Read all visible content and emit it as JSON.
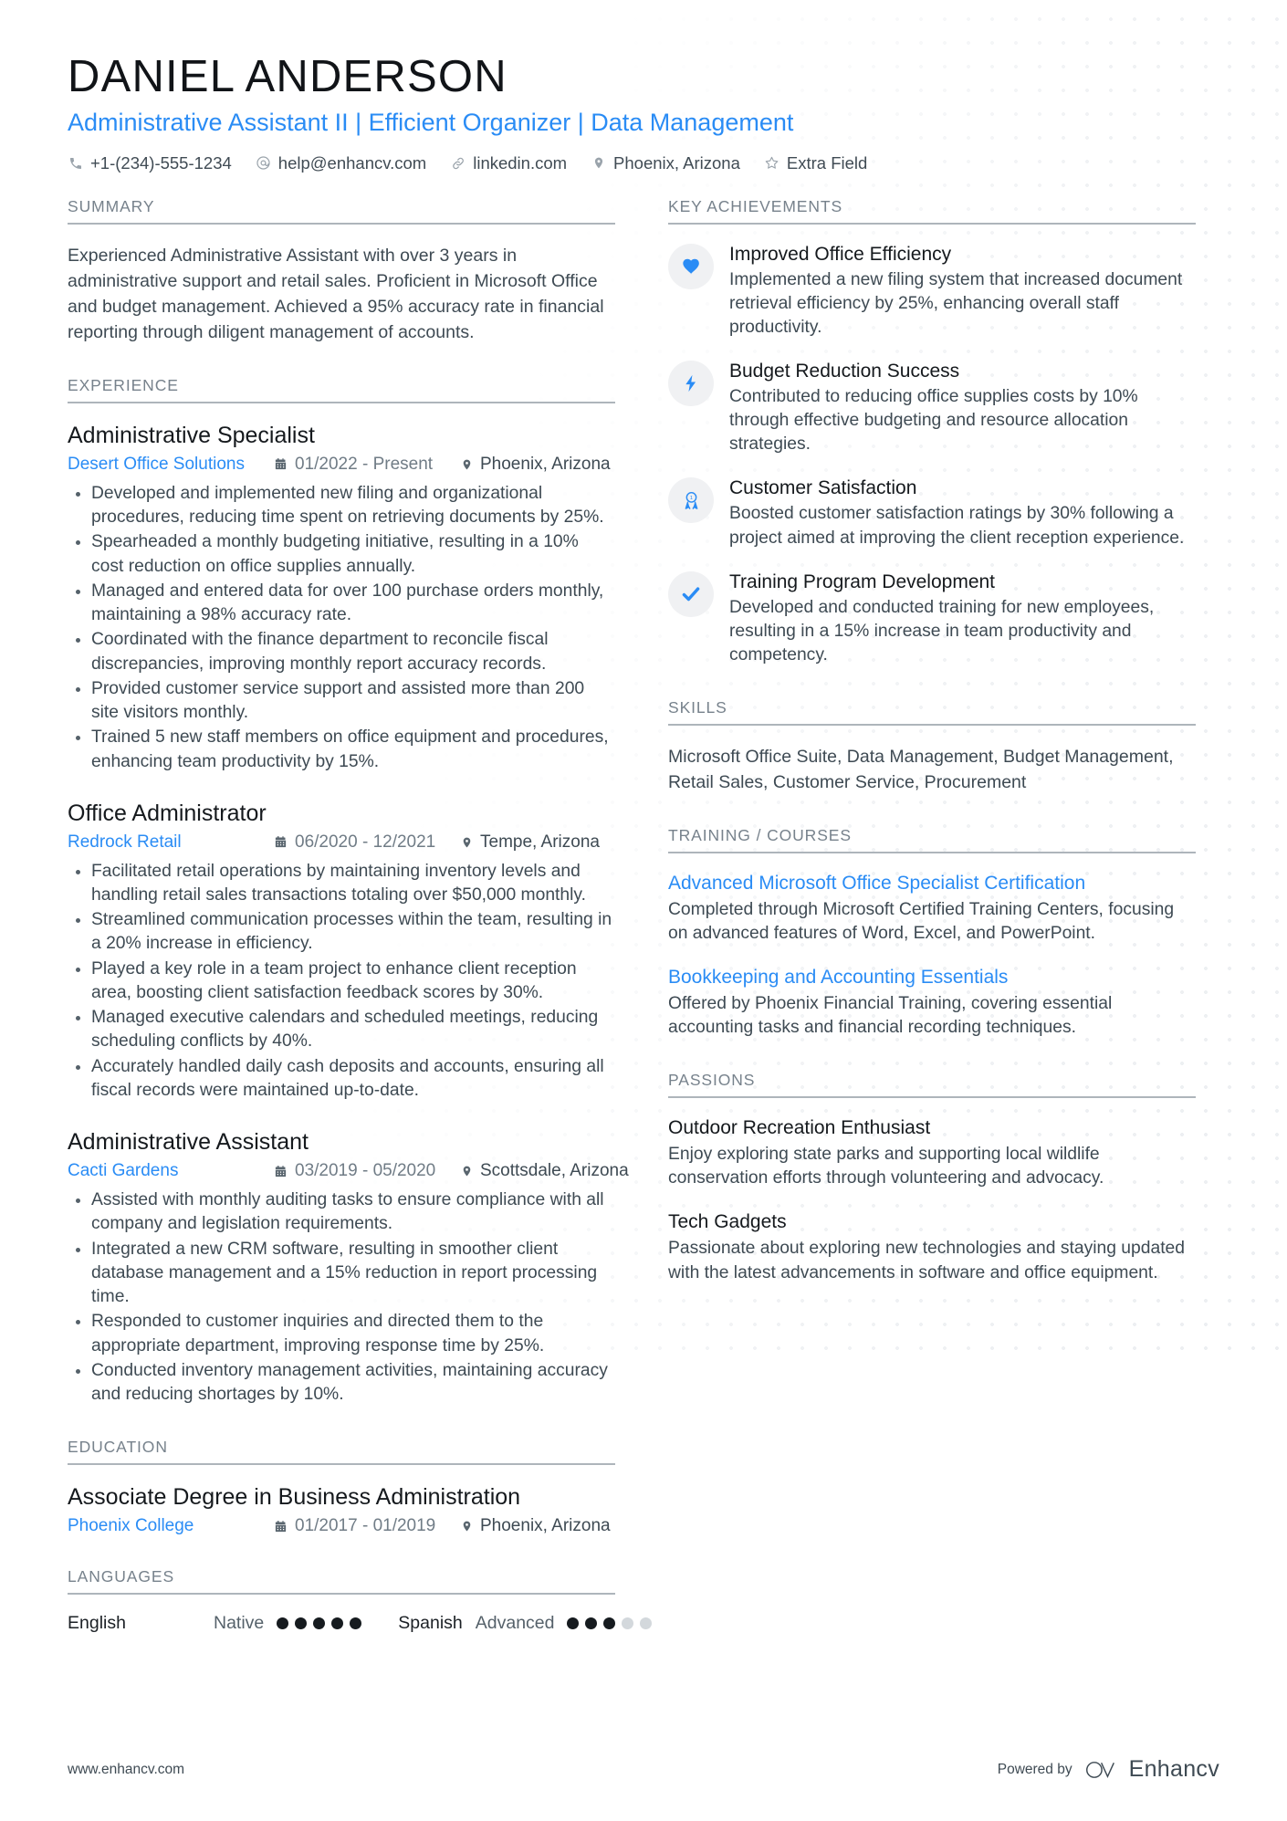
{
  "header": {
    "name": "DANIEL ANDERSON",
    "headline": "Administrative Assistant II | Efficient Organizer | Data Management",
    "contacts": [
      {
        "icon": "phone-icon",
        "text": "+1-(234)-555-1234"
      },
      {
        "icon": "email-icon",
        "text": "help@enhancv.com"
      },
      {
        "icon": "link-icon",
        "text": "linkedin.com"
      },
      {
        "icon": "location-pin-icon",
        "text": "Phoenix, Arizona"
      },
      {
        "icon": "star-icon",
        "text": "Extra Field"
      }
    ]
  },
  "summary": {
    "title": "SUMMARY",
    "text": "Experienced Administrative Assistant with over 3 years in administrative support and retail sales. Proficient in Microsoft Office and budget management. Achieved a 95% accuracy rate in financial reporting through diligent management of accounts."
  },
  "experience": {
    "title": "EXPERIENCE",
    "jobs": [
      {
        "title": "Administrative Specialist",
        "company": "Desert Office Solutions",
        "date": "01/2022 - Present",
        "location": "Phoenix, Arizona",
        "bullets": [
          "Developed and implemented new filing and organizational procedures, reducing time spent on retrieving documents by 25%.",
          "Spearheaded a monthly budgeting initiative, resulting in a 10% cost reduction on office supplies annually.",
          "Managed and entered data for over 100 purchase orders monthly, maintaining a 98% accuracy rate.",
          "Coordinated with the finance department to reconcile fiscal discrepancies, improving monthly report accuracy records.",
          "Provided customer service support and assisted more than 200 site visitors monthly.",
          "Trained 5 new staff members on office equipment and procedures, enhancing team productivity by 15%."
        ]
      },
      {
        "title": "Office Administrator",
        "company": "Redrock Retail",
        "date": "06/2020 - 12/2021",
        "location": "Tempe, Arizona",
        "bullets": [
          "Facilitated retail operations by maintaining inventory levels and handling retail sales transactions totaling over $50,000 monthly.",
          "Streamlined communication processes within the team, resulting in a 20% increase in efficiency.",
          "Played a key role in a team project to enhance client reception area, boosting client satisfaction feedback scores by 30%.",
          "Managed executive calendars and scheduled meetings, reducing scheduling conflicts by 40%.",
          "Accurately handled daily cash deposits and accounts, ensuring all fiscal records were maintained up-to-date."
        ]
      },
      {
        "title": "Administrative Assistant",
        "company": "Cacti Gardens",
        "date": "03/2019 - 05/2020",
        "location": "Scottsdale, Arizona",
        "bullets": [
          "Assisted with monthly auditing tasks to ensure compliance with all company and legislation requirements.",
          "Integrated a new CRM software, resulting in smoother client database management and a 15% reduction in report processing time.",
          "Responded to customer inquiries and directed them to the appropriate department, improving response time by 25%.",
          "Conducted inventory management activities, maintaining accuracy and reducing shortages by 10%."
        ]
      }
    ]
  },
  "education": {
    "title": "EDUCATION",
    "entries": [
      {
        "degree": "Associate Degree in Business Administration",
        "school": "Phoenix College",
        "date": "01/2017 - 01/2019",
        "location": "Phoenix, Arizona"
      }
    ]
  },
  "languages": {
    "title": "LANGUAGES",
    "items": [
      {
        "name": "English",
        "level": "Native",
        "filled": 5,
        "total": 5
      },
      {
        "name": "Spanish",
        "level": "Advanced",
        "filled": 3,
        "total": 5
      }
    ]
  },
  "achievements": {
    "title": "KEY ACHIEVEMENTS",
    "items": [
      {
        "icon": "heart-icon",
        "title": "Improved Office Efficiency",
        "desc": "Implemented a new filing system that increased document retrieval efficiency by 25%, enhancing overall staff productivity."
      },
      {
        "icon": "lightning-bolt-icon",
        "title": "Budget Reduction Success",
        "desc": "Contributed to reducing office supplies costs by 10% through effective budgeting and resource allocation strategies."
      },
      {
        "icon": "award-medal-icon",
        "title": "Customer Satisfaction",
        "desc": "Boosted customer satisfaction ratings by 30% following a project aimed at improving the client reception experience."
      },
      {
        "icon": "checkmark-icon",
        "title": "Training Program Development",
        "desc": "Developed and conducted training for new employees, resulting in a 15% increase in team productivity and competency."
      }
    ]
  },
  "skills": {
    "title": "SKILLS",
    "text": "Microsoft Office Suite, Data Management, Budget Management, Retail Sales, Customer Service, Procurement"
  },
  "training": {
    "title": "TRAINING / COURSES",
    "items": [
      {
        "title": "Advanced Microsoft Office Specialist Certification",
        "desc": "Completed through Microsoft Certified Training Centers, focusing on advanced features of Word, Excel, and PowerPoint."
      },
      {
        "title": "Bookkeeping and Accounting Essentials",
        "desc": "Offered by Phoenix Financial Training, covering essential accounting tasks and financial recording techniques."
      }
    ]
  },
  "passions": {
    "title": "PASSIONS",
    "items": [
      {
        "title": "Outdoor Recreation Enthusiast",
        "desc": "Enjoy exploring state parks and supporting local wildlife conservation efforts through volunteering and advocacy."
      },
      {
        "title": "Tech Gadgets",
        "desc": "Passionate about exploring new technologies and staying updated with the latest advancements in software and office equipment."
      }
    ]
  },
  "footer": {
    "url": "www.enhancv.com",
    "powered_by": "Powered by",
    "brand": "Enhancv"
  },
  "colors": {
    "accent": "#2a8cf5",
    "text": "#3e4a53",
    "heading": "#15191d",
    "muted": "#77828c"
  }
}
